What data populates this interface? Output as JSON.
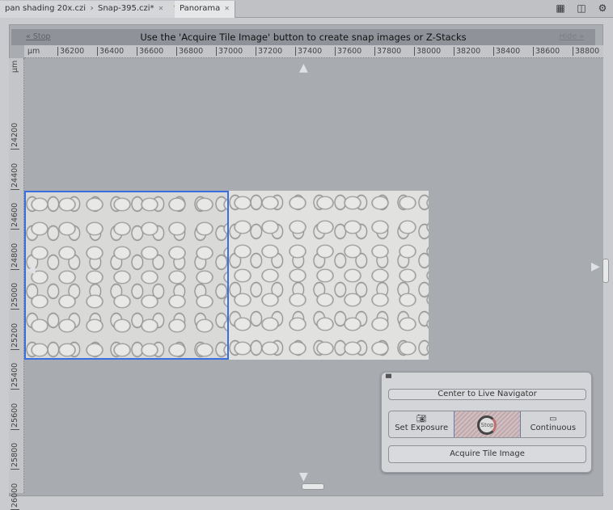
{
  "tabs": [
    {
      "label": "pan shading 20x.czi"
    },
    {
      "label": "Snap-395.czi*"
    },
    {
      "label": "Panorama"
    }
  ],
  "toolbar": {
    "icons": [
      "grid-view-icon",
      "split-view-icon",
      "gear-icon"
    ]
  },
  "banner": {
    "stop": "« Stop",
    "message": "Use the 'Acquire Tile Image' button to create snap images or Z-Stacks",
    "hide": "Hide »"
  },
  "ruler": {
    "unit": "µm",
    "x_ticks": [
      "36200",
      "36400",
      "36600",
      "36800",
      "37000",
      "37200",
      "37400",
      "37600",
      "37800",
      "38000",
      "38200",
      "38400",
      "38600",
      "38800"
    ],
    "y_ticks": [
      "24200",
      "24400",
      "24600",
      "24800",
      "25000",
      "25200",
      "25400",
      "25600",
      "25800",
      "26000"
    ]
  },
  "panel": {
    "center": "Center to Live Navigator",
    "set_exposure": "Set Exposure",
    "stop": "Stop",
    "continuous": "Continuous",
    "acquire": "Acquire Tile Image"
  }
}
